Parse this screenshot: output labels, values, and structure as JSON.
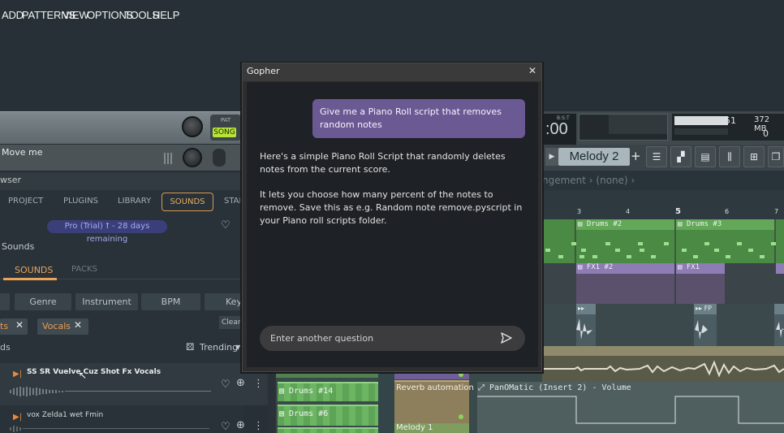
{
  "menubar": {
    "items": [
      "ADD",
      "PATTERNS",
      "VIEW",
      "OPTIONS",
      "TOOLS",
      "HELP"
    ],
    "pat": "PAT",
    "song": "SONG"
  },
  "hint": {
    "text": "Move me"
  },
  "browser": {
    "title": "wser",
    "tabs": [
      "PROJECT",
      "PLUGINS",
      "LIBRARY",
      "SOUNDS",
      "STAR"
    ],
    "pro_badge": "Pro (Trial) ⭡ - 28 days remaining",
    "section": "Sounds",
    "subtabs": [
      "SOUNDS",
      "PACKS"
    ],
    "filters": [
      "Genre",
      "Instrument",
      "BPM",
      "Key"
    ],
    "chips": [
      "ts",
      "Vocals"
    ],
    "clear": "Clear",
    "list_label": "ds",
    "sort": "Trending",
    "items": [
      {
        "title": "SS SR Vuelve Cuz Shot Fx Vocals"
      },
      {
        "title": "vox Zelda1 wet Fmin"
      }
    ]
  },
  "transport": {
    "bst": "B:S:T",
    "time": ":00",
    "cpu": "51",
    "mem": "372 MB",
    "poly": "0",
    "pattern": "Melody 2"
  },
  "arrangement": {
    "label": "ngement › (none) ›"
  },
  "ruler": {
    "bar3": "3",
    "bar4": "4",
    "bar5": "5",
    "bar6": "6",
    "bar7": "7"
  },
  "playlist": {
    "drums2": "Drums #2",
    "drums3": "Drums #3",
    "fx2": "FX1 #2",
    "fx1": "FX1",
    "fp": "FP",
    "drums14": "Drums #14",
    "drums6": "Drums #6",
    "reverb": "Reverb automation",
    "melody1": "Melody 1",
    "pan": "PanOMatic (Insert 2) - Volume"
  },
  "dialog": {
    "title": "Gopher",
    "user_message": "Give me a Piano Roll script that removes random notes",
    "response_1": "Here's a simple Piano Roll Script that randomly deletes notes from the current score.",
    "response_2": "It lets you choose how many percent of the notes to remove. Save this as e.g. Random note remove.pyscript in your Piano roll scripts folder.",
    "input_placeholder": "Enter another question"
  },
  "colors": {
    "accent_purple": "#6b5994",
    "sounds_orange": "#e9a45a",
    "song_green": "#b7e33a"
  }
}
